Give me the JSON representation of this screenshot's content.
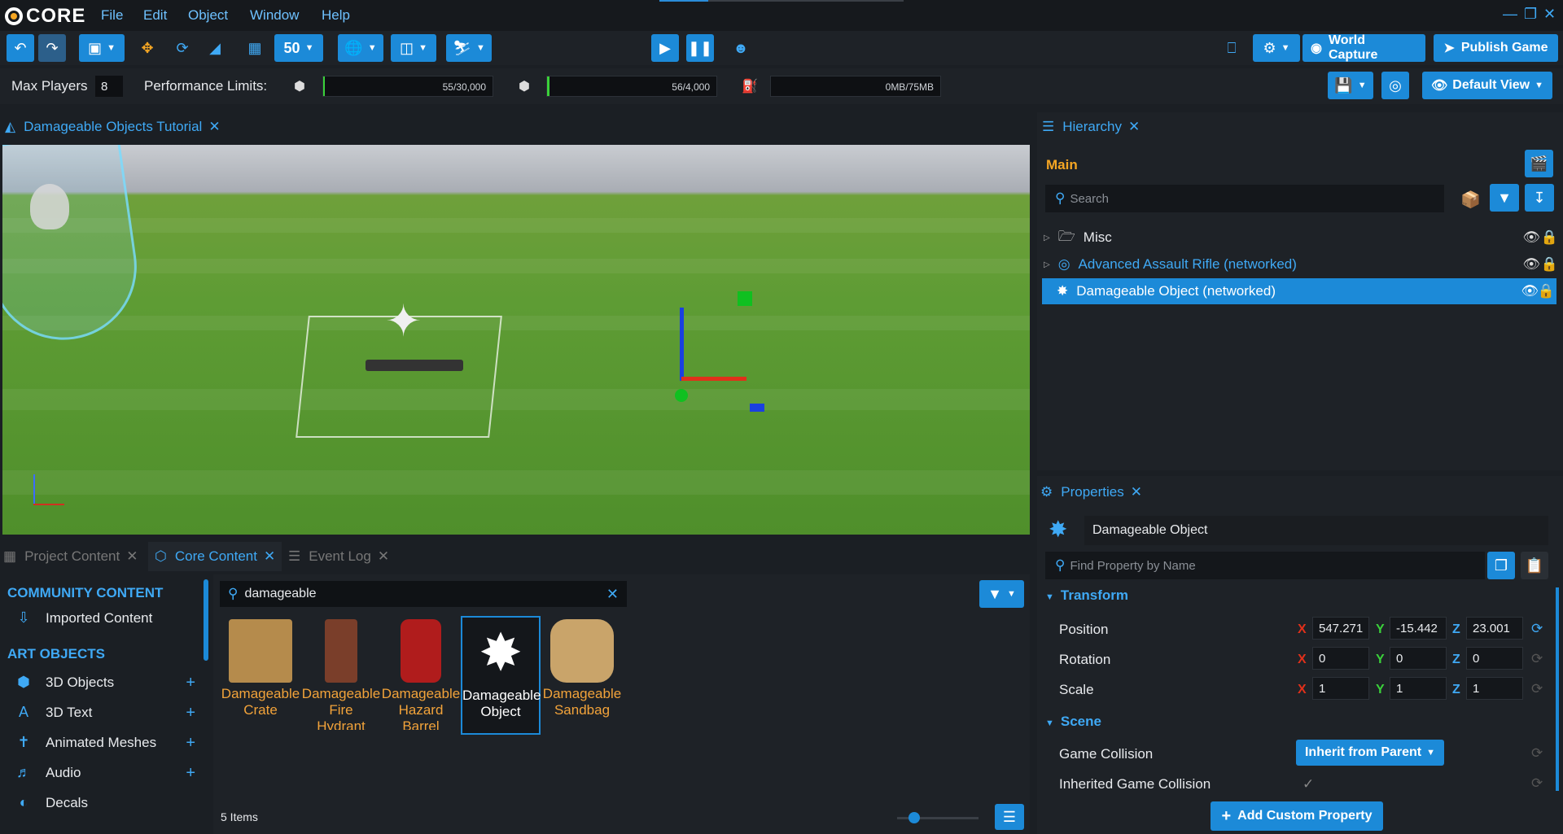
{
  "app": {
    "logo": "CORE"
  },
  "menu": [
    "File",
    "Edit",
    "Object",
    "Window",
    "Help"
  ],
  "toolbar": {
    "grid_value": "50",
    "world_capture": "World Capture",
    "publish_game": "Publish Game"
  },
  "perf": {
    "max_players_label": "Max Players",
    "max_players_value": "8",
    "limits_label": "Performance Limits:",
    "objects": "55/30,000",
    "networked": "56/4,000",
    "memory": "0MB/75MB",
    "objects_fraction": 0.0018,
    "networked_fraction": 0.014,
    "memory_fraction": 0
  },
  "view_button": "Default View",
  "viewport": {
    "tab": "Damageable Objects Tutorial"
  },
  "bottom_tabs": [
    "Project Content",
    "Core Content",
    "Event Log"
  ],
  "content": {
    "community_heading": "COMMUNITY CONTENT",
    "imported": "Imported Content",
    "art_heading": "ART OBJECTS",
    "categories": [
      "3D Objects",
      "3D Text",
      "Animated Meshes",
      "Audio",
      "Decals"
    ],
    "search_value": "damageable",
    "items_count": "5 Items",
    "assets": [
      {
        "line1": "Damageable",
        "line2": "Crate",
        "line3": ""
      },
      {
        "line1": "Damageable",
        "line2": "Fire",
        "line3": "Hydrant"
      },
      {
        "line1": "Damageable",
        "line2": "Hazard",
        "line3": "Barrel"
      },
      {
        "line1": "Damageable",
        "line2": "Object",
        "line3": ""
      },
      {
        "line1": "Damageable",
        "line2": "Sandbag",
        "line3": ""
      }
    ]
  },
  "hierarchy": {
    "tab": "Hierarchy",
    "scope": "Main",
    "search_placeholder": "Search",
    "rows": [
      "Misc",
      "Advanced Assault Rifle (networked)",
      "Damageable Object (networked)"
    ]
  },
  "properties": {
    "tab": "Properties",
    "name": "Damageable Object",
    "find_placeholder": "Find Property by Name",
    "transform_heading": "Transform",
    "position_label": "Position",
    "rotation_label": "Rotation",
    "scale_label": "Scale",
    "axes": [
      "X",
      "Y",
      "Z"
    ],
    "position": [
      "547.271",
      "-15.442",
      "23.001"
    ],
    "rotation": [
      "0",
      "0",
      "0"
    ],
    "scale": [
      "1",
      "1",
      "1"
    ],
    "scene_heading": "Scene",
    "game_collision_label": "Game Collision",
    "game_collision_value": "Inherit from Parent",
    "inherited_label": "Inherited Game Collision",
    "add_custom": "Add Custom Property"
  }
}
